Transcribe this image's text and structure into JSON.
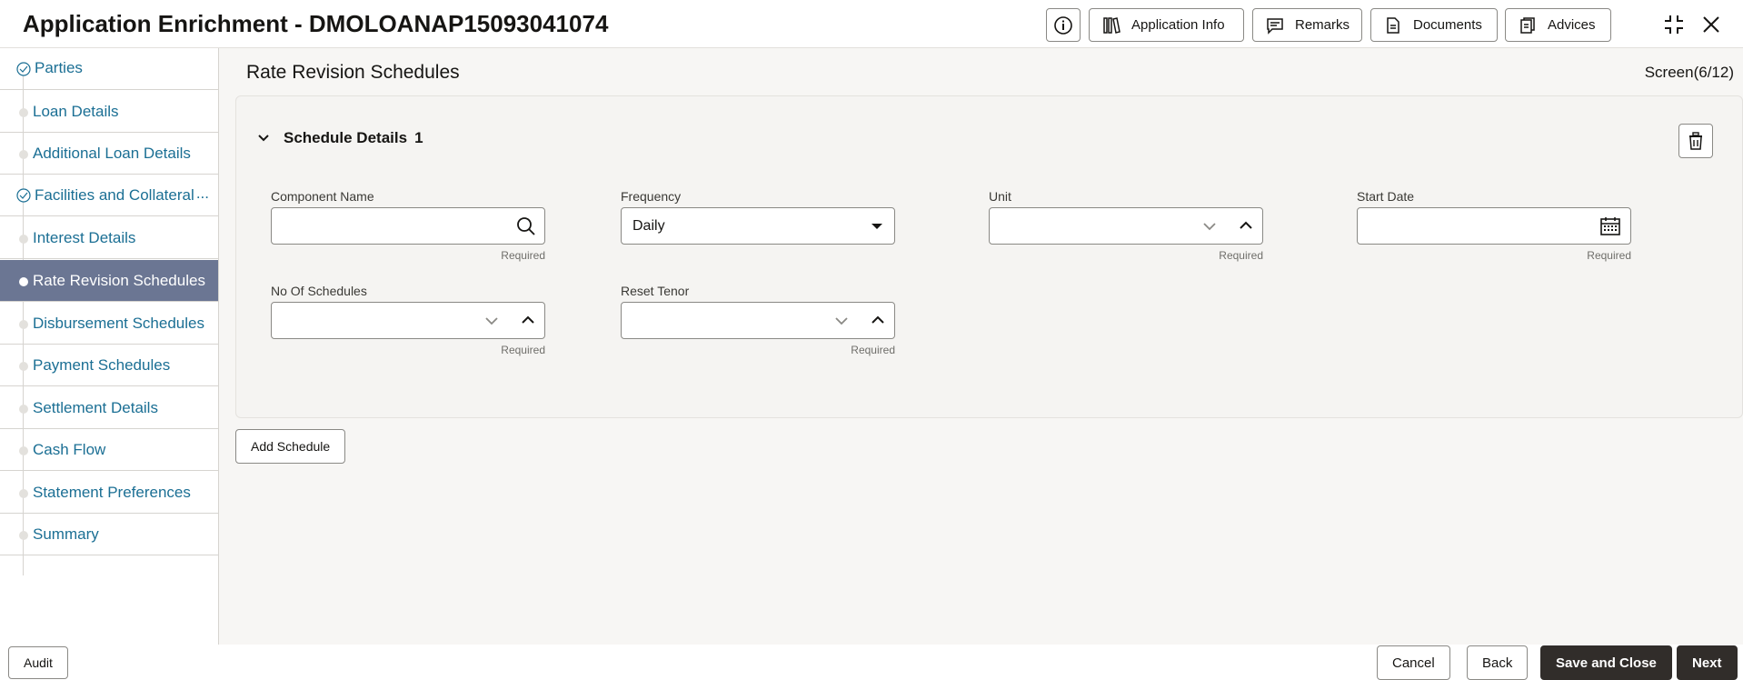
{
  "header": {
    "title": "Application Enrichment - DMOLOANAP15093041074",
    "buttons": {
      "info_icon": "info-icon",
      "application_info": "Application Info",
      "remarks": "Remarks",
      "documents": "Documents",
      "advices": "Advices"
    }
  },
  "sidebar": {
    "items": [
      {
        "label": "Parties",
        "state": "completed"
      },
      {
        "label": "Loan Details",
        "state": "pending"
      },
      {
        "label": "Additional Loan Details",
        "state": "pending"
      },
      {
        "label": "Facilities and Collateral",
        "state": "completed",
        "more": "..."
      },
      {
        "label": "Interest Details",
        "state": "pending"
      },
      {
        "label": "Rate Revision Schedules",
        "state": "active"
      },
      {
        "label": "Disbursement Schedules",
        "state": "pending"
      },
      {
        "label": "Payment Schedules",
        "state": "pending"
      },
      {
        "label": "Settlement Details",
        "state": "pending"
      },
      {
        "label": "Cash Flow",
        "state": "pending"
      },
      {
        "label": "Statement Preferences",
        "state": "pending"
      },
      {
        "label": "Summary",
        "state": "pending"
      }
    ]
  },
  "main": {
    "title": "Rate Revision Schedules",
    "screen": "Screen(6/12)",
    "section": {
      "title": "Schedule Details",
      "number": "1"
    },
    "fields": {
      "component_name": {
        "label": "Component Name",
        "value": "",
        "required": "Required"
      },
      "frequency": {
        "label": "Frequency",
        "value": "Daily"
      },
      "unit": {
        "label": "Unit",
        "value": "",
        "required": "Required"
      },
      "start_date": {
        "label": "Start Date",
        "value": "",
        "required": "Required"
      },
      "no_of_schedules": {
        "label": "No Of Schedules",
        "value": "",
        "required": "Required"
      },
      "reset_tenor": {
        "label": "Reset Tenor",
        "value": "",
        "required": "Required"
      }
    },
    "add_schedule": "Add Schedule"
  },
  "footer": {
    "audit": "Audit",
    "cancel": "Cancel",
    "back": "Back",
    "save_and_close": "Save and Close",
    "next": "Next"
  }
}
